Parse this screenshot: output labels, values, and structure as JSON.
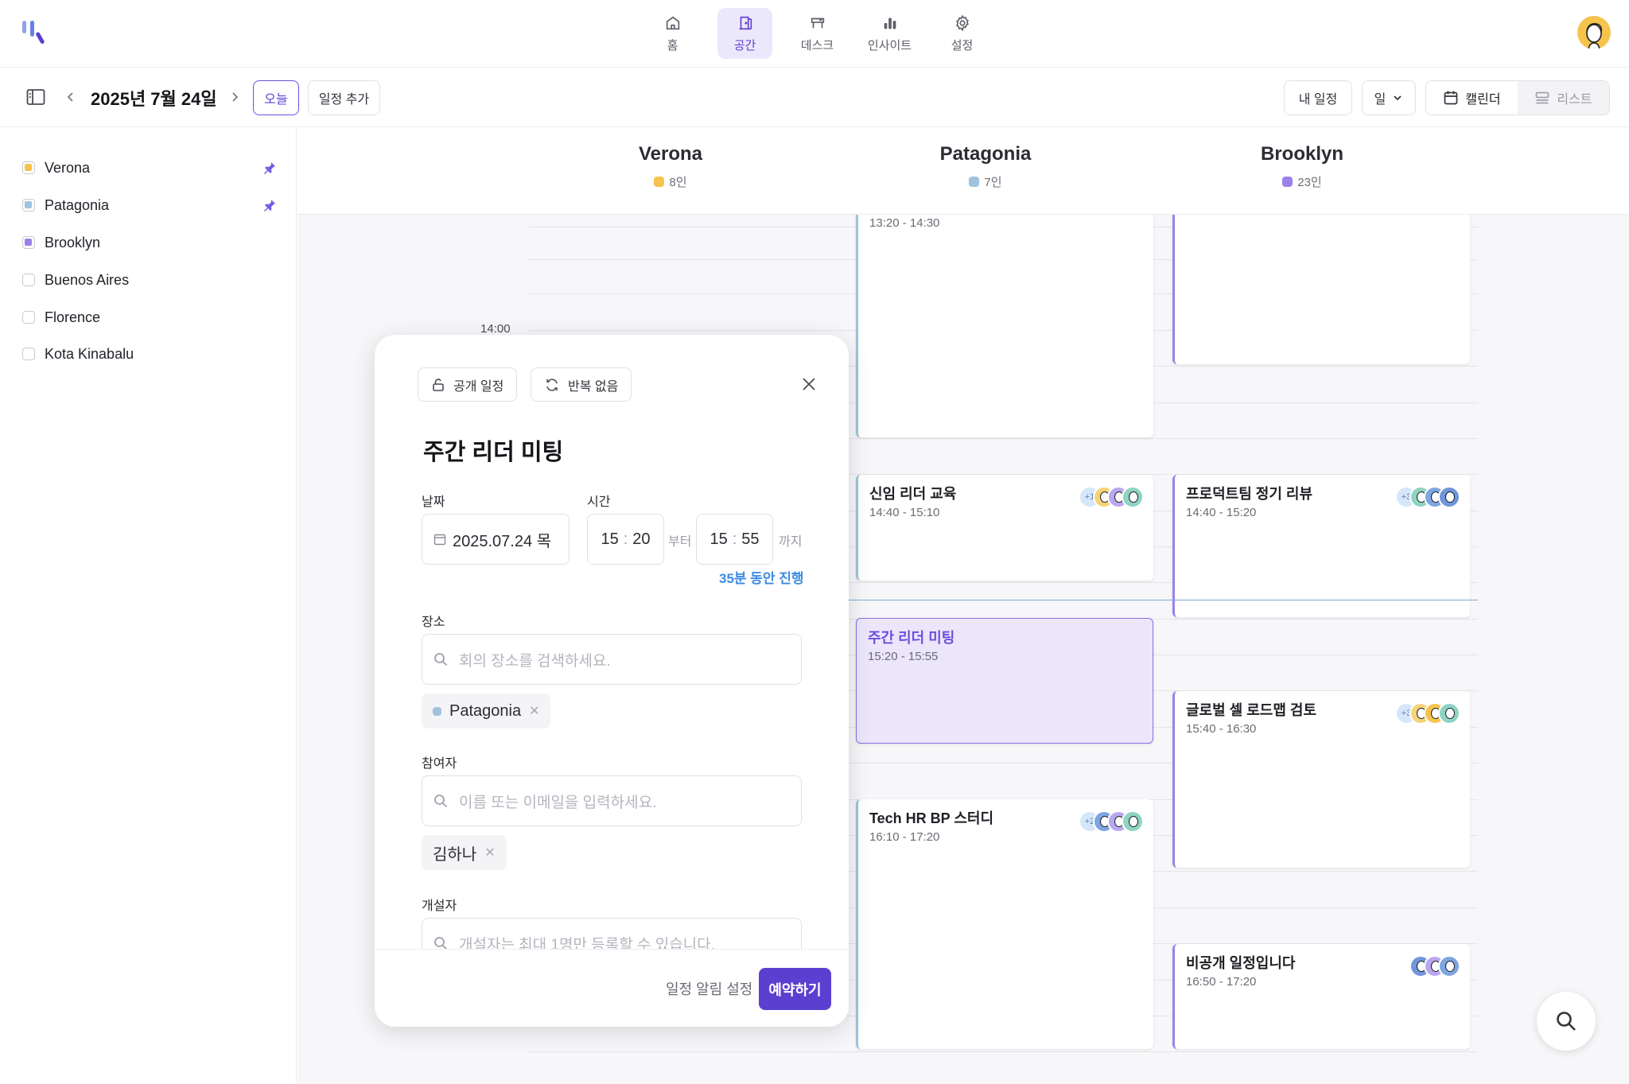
{
  "nav": {
    "tabs": [
      {
        "label": "홈",
        "icon": "home-icon"
      },
      {
        "label": "공간",
        "icon": "door-icon"
      },
      {
        "label": "데스크",
        "icon": "desk-icon"
      },
      {
        "label": "인사이트",
        "icon": "bar-chart-icon"
      },
      {
        "label": "설정",
        "icon": "gear-icon"
      }
    ],
    "active": "공간"
  },
  "toolbar": {
    "date": "2025년 7월 24일",
    "today": "오늘",
    "add_event": "일정 추가",
    "my_events": "내 일정",
    "view_unit": "일",
    "calendar_view": "캘린더",
    "list_view": "리스트"
  },
  "sidebar": {
    "spaces": [
      {
        "name": "Verona",
        "checked": true,
        "color": "#f6c34d",
        "pinned": true
      },
      {
        "name": "Patagonia",
        "checked": true,
        "color": "#9fc3dc",
        "pinned": true
      },
      {
        "name": "Brooklyn",
        "checked": true,
        "color": "#9b82e8",
        "pinned": false
      },
      {
        "name": "Buenos Aires",
        "checked": false,
        "pinned": false
      },
      {
        "name": "Florence",
        "checked": false,
        "pinned": false
      },
      {
        "name": "Kota Kinabalu",
        "checked": false,
        "pinned": false
      }
    ]
  },
  "calendar": {
    "columns": [
      {
        "name": "Verona",
        "count": "8인",
        "color": "#f6c34d"
      },
      {
        "name": "Patagonia",
        "count": "7인",
        "color": "#9fc3dc"
      },
      {
        "name": "Brooklyn",
        "count": "23인",
        "color": "#9b82e8"
      }
    ],
    "time_label": "14:00",
    "events": {
      "p1": {
        "time": "13:20 - 14:30"
      },
      "p2": {
        "title": "신임 리더 교육",
        "time": "14:40 - 15:10",
        "more": "+1"
      },
      "p3": {
        "title": "주간 리더 미팅",
        "time": "15:20 - 15:55"
      },
      "p4": {
        "title": "Tech HR BP 스터디",
        "time": "16:10 - 17:20",
        "more": "+2"
      },
      "b2": {
        "title": "프로덕트팀 정기 리뷰",
        "time": "14:40 - 15:20",
        "more": "+3"
      },
      "b3": {
        "title": "글로벌 셀 로드맵 검토",
        "time": "15:40 - 16:30",
        "more": "+3"
      },
      "b4": {
        "title": "비공개 일정입니다",
        "time": "16:50 - 17:20"
      }
    }
  },
  "modal": {
    "visibility": "공개 일정",
    "repeat": "반복 없음",
    "title": "주간 리더 미팅",
    "date_label": "날짜",
    "date_value": "2025.07.24 목",
    "time_label": "시간",
    "start_h": "15",
    "start_m": "20",
    "end_h": "15",
    "end_m": "55",
    "from": "부터",
    "to": "까지",
    "duration": "35분 동안 진행",
    "location_label": "장소",
    "location_placeholder": "회의 장소를 검색하세요.",
    "location_tag": "Patagonia",
    "participants_label": "참여자",
    "participants_placeholder": "이름 또는 이메일을 입력하세요.",
    "participant_tag": "김하나",
    "organizer_label": "개설자",
    "organizer_placeholder": "개설자는 최대 1명만 등록할 수 있습니다.",
    "alert_settings": "일정 알림 설정",
    "reserve": "예약하기"
  }
}
